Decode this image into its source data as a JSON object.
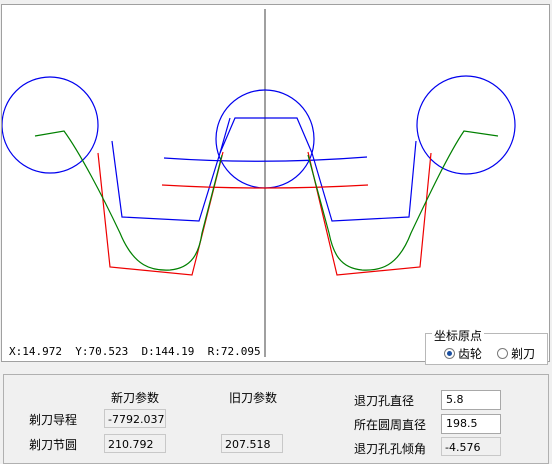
{
  "canvas": {
    "colors": {
      "axis": "#808080",
      "blue": "#0000ee",
      "red": "#ee0000",
      "green": "#008000"
    },
    "readout": "X:14.972  Y:70.523  D:144.19  R:72.095"
  },
  "origin_group": {
    "title": "坐标原点",
    "options": [
      {
        "label": "齿轮",
        "selected": true
      },
      {
        "label": "剃刀",
        "selected": false
      }
    ]
  },
  "params": {
    "col_new": "新刀参数",
    "col_old": "旧刀参数",
    "rows": [
      {
        "label": "剃刀导程",
        "new_value": "-7792.037",
        "old_value": ""
      },
      {
        "label": "剃刀节圆",
        "new_value": "210.792",
        "old_value": "207.518"
      }
    ],
    "right": [
      {
        "label": "退刀孔直径",
        "value": "5.8"
      },
      {
        "label": "所在圆周直径",
        "value": "198.5"
      },
      {
        "label": "退刀孔孔倾角",
        "value": "-4.576"
      }
    ]
  }
}
